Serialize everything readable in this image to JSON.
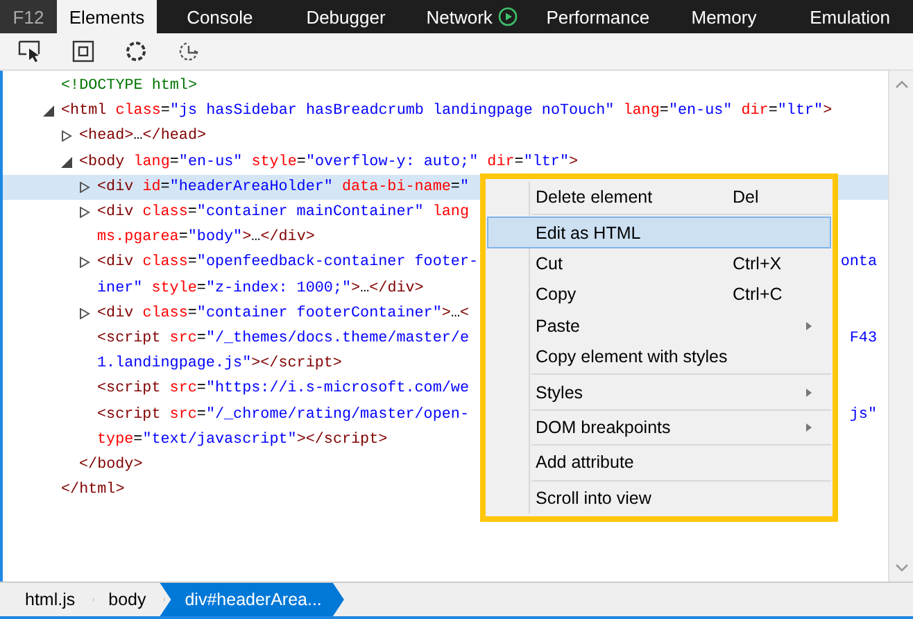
{
  "brand": "F12",
  "tabs": [
    {
      "label": "Elements",
      "kind": "plain",
      "selected": true
    },
    {
      "label": "Console",
      "kind": "plain",
      "selected": false
    },
    {
      "label": "Debugger",
      "kind": "plain",
      "selected": false
    },
    {
      "label": "Network",
      "kind": "recording",
      "selected": false
    },
    {
      "label": "Performance",
      "kind": "plain",
      "selected": false
    },
    {
      "label": "Memory",
      "kind": "plain",
      "selected": false
    },
    {
      "label": "Emulation",
      "kind": "plain",
      "selected": false
    }
  ],
  "toolbar": [
    {
      "kind": "select"
    },
    {
      "kind": "box"
    },
    {
      "kind": "ring"
    },
    {
      "kind": "timer"
    }
  ],
  "tree": [
    {
      "kind": "leaf",
      "selected": false,
      "lines": [
        {
          "tokens": [
            {
              "kind": "doctype",
              "text": "<!DOCTYPE html>"
            }
          ]
        }
      ]
    },
    {
      "kind": "branch",
      "expanded": true,
      "selected": false,
      "lines": [
        {
          "tokens": [
            {
              "kind": "tag",
              "text": "<html"
            },
            {
              "kind": "attr",
              "text": " class"
            },
            {
              "kind": "punct",
              "text": "="
            },
            {
              "kind": "val",
              "text": "\"js hasSidebar hasBreadcrumb landingpage noTouch\""
            },
            {
              "kind": "attr",
              "text": " lang"
            },
            {
              "kind": "punct",
              "text": "="
            },
            {
              "kind": "val",
              "text": "\"en-us\""
            },
            {
              "kind": "attr",
              "text": " dir"
            },
            {
              "kind": "punct",
              "text": "="
            },
            {
              "kind": "val",
              "text": "\"ltr\""
            },
            {
              "kind": "tag",
              "text": ">"
            }
          ]
        }
      ],
      "children": [
        {
          "kind": "branch",
          "expanded": false,
          "selected": false,
          "lines": [
            {
              "tokens": [
                {
                  "kind": "tag",
                  "text": "<head>"
                },
                {
                  "kind": "punct",
                  "text": "…"
                },
                {
                  "kind": "tag",
                  "text": "</head>"
                }
              ]
            }
          ]
        },
        {
          "kind": "branch",
          "expanded": true,
          "selected": false,
          "lines": [
            {
              "tokens": [
                {
                  "kind": "tag",
                  "text": "<body"
                },
                {
                  "kind": "attr",
                  "text": " lang"
                },
                {
                  "kind": "punct",
                  "text": "="
                },
                {
                  "kind": "val",
                  "text": "\"en-us\""
                },
                {
                  "kind": "attr",
                  "text": " style"
                },
                {
                  "kind": "punct",
                  "text": "="
                },
                {
                  "kind": "val",
                  "text": "\"overflow-y: auto;\""
                },
                {
                  "kind": "attr",
                  "text": " dir"
                },
                {
                  "kind": "punct",
                  "text": "="
                },
                {
                  "kind": "val",
                  "text": "\"ltr\""
                },
                {
                  "kind": "tag",
                  "text": ">"
                }
              ]
            }
          ],
          "children": [
            {
              "kind": "branch",
              "expanded": false,
              "selected": true,
              "lines": [
                {
                  "tokens": [
                    {
                      "kind": "tag",
                      "text": "<div"
                    },
                    {
                      "kind": "attr",
                      "text": " id"
                    },
                    {
                      "kind": "punct",
                      "text": "="
                    },
                    {
                      "kind": "val",
                      "text": "\"headerAreaHolder\""
                    },
                    {
                      "kind": "attr",
                      "text": " data-bi-name"
                    },
                    {
                      "kind": "punct",
                      "text": "="
                    },
                    {
                      "kind": "val",
                      "text": "\""
                    }
                  ]
                }
              ]
            },
            {
              "kind": "branch",
              "expanded": false,
              "selected": false,
              "lines": [
                {
                  "tokens": [
                    {
                      "kind": "tag",
                      "text": "<div"
                    },
                    {
                      "kind": "attr",
                      "text": " class"
                    },
                    {
                      "kind": "punct",
                      "text": "="
                    },
                    {
                      "kind": "val",
                      "text": "\"container mainContainer\""
                    },
                    {
                      "kind": "attr",
                      "text": " lang"
                    }
                  ]
                },
                {
                  "tokens": [
                    {
                      "kind": "attr",
                      "text": "ms.pgarea"
                    },
                    {
                      "kind": "punct",
                      "text": "="
                    },
                    {
                      "kind": "val",
                      "text": "\"body\""
                    },
                    {
                      "kind": "tag",
                      "text": ">"
                    },
                    {
                      "kind": "punct",
                      "text": "…"
                    },
                    {
                      "kind": "tag",
                      "text": "</div>"
                    }
                  ]
                }
              ]
            },
            {
              "kind": "branch",
              "expanded": false,
              "selected": false,
              "lines": [
                {
                  "tokens": [
                    {
                      "kind": "tag",
                      "text": "<div"
                    },
                    {
                      "kind": "attr",
                      "text": " class"
                    },
                    {
                      "kind": "punct",
                      "text": "="
                    },
                    {
                      "kind": "val",
                      "text": "\"openfeedback-container footer-"
                    }
                  ],
                  "right": [
                    {
                      "kind": "val",
                      "text": "onta"
                    }
                  ]
                },
                {
                  "tokens": [
                    {
                      "kind": "val",
                      "text": "iner\""
                    },
                    {
                      "kind": "attr",
                      "text": " style"
                    },
                    {
                      "kind": "punct",
                      "text": "="
                    },
                    {
                      "kind": "val",
                      "text": "\"z-index: 1000;\""
                    },
                    {
                      "kind": "tag",
                      "text": ">"
                    },
                    {
                      "kind": "punct",
                      "text": "…"
                    },
                    {
                      "kind": "tag",
                      "text": "</div>"
                    }
                  ]
                }
              ]
            },
            {
              "kind": "branch",
              "expanded": false,
              "selected": false,
              "lines": [
                {
                  "tokens": [
                    {
                      "kind": "tag",
                      "text": "<div"
                    },
                    {
                      "kind": "attr",
                      "text": " class"
                    },
                    {
                      "kind": "punct",
                      "text": "="
                    },
                    {
                      "kind": "val",
                      "text": "\"container footerContainer\""
                    },
                    {
                      "kind": "tag",
                      "text": ">"
                    },
                    {
                      "kind": "punct",
                      "text": "…"
                    },
                    {
                      "kind": "tag",
                      "text": "<"
                    }
                  ]
                }
              ]
            },
            {
              "kind": "leaf",
              "selected": false,
              "lines": [
                {
                  "tokens": [
                    {
                      "kind": "tag",
                      "text": "<script"
                    },
                    {
                      "kind": "attr",
                      "text": " src"
                    },
                    {
                      "kind": "punct",
                      "text": "="
                    },
                    {
                      "kind": "val",
                      "text": "\"/_themes/docs.theme/master/e"
                    }
                  ],
                  "right": [
                    {
                      "kind": "val",
                      "text": "F43"
                    }
                  ]
                },
                {
                  "tokens": [
                    {
                      "kind": "val",
                      "text": "1.landingpage.js\""
                    },
                    {
                      "kind": "tag",
                      "text": "></script>"
                    }
                  ]
                }
              ]
            },
            {
              "kind": "leaf",
              "selected": false,
              "lines": [
                {
                  "tokens": [
                    {
                      "kind": "tag",
                      "text": "<script"
                    },
                    {
                      "kind": "attr",
                      "text": " src"
                    },
                    {
                      "kind": "punct",
                      "text": "="
                    },
                    {
                      "kind": "val",
                      "text": "\"https://i.s-microsoft.com/we"
                    }
                  ]
                }
              ]
            },
            {
              "kind": "leaf",
              "selected": false,
              "lines": [
                {
                  "tokens": [
                    {
                      "kind": "tag",
                      "text": "<script"
                    },
                    {
                      "kind": "attr",
                      "text": " src"
                    },
                    {
                      "kind": "punct",
                      "text": "="
                    },
                    {
                      "kind": "val",
                      "text": "\"/_chrome/rating/master/open-"
                    }
                  ],
                  "right": [
                    {
                      "kind": "val",
                      "text": "js\""
                    }
                  ]
                },
                {
                  "tokens": [
                    {
                      "kind": "attr",
                      "text": "type"
                    },
                    {
                      "kind": "punct",
                      "text": "="
                    },
                    {
                      "kind": "val",
                      "text": "\"text/javascript\""
                    },
                    {
                      "kind": "tag",
                      "text": "></script>"
                    }
                  ]
                }
              ]
            }
          ]
        },
        {
          "kind": "leaf",
          "selected": false,
          "lines": [
            {
              "tokens": [
                {
                  "kind": "tag",
                  "text": "</body>"
                }
              ]
            }
          ]
        }
      ]
    },
    {
      "kind": "leaf",
      "selected": false,
      "lines": [
        {
          "tokens": [
            {
              "kind": "tag",
              "text": "</html>"
            }
          ]
        }
      ]
    }
  ],
  "context_menu": [
    {
      "label": "Delete element",
      "shortcut": "Del",
      "submenu": false,
      "selected": false,
      "separator_after": true
    },
    {
      "label": "Edit as HTML",
      "submenu": false,
      "selected": true,
      "separator_after": false
    },
    {
      "label": "Cut",
      "shortcut": "Ctrl+X",
      "submenu": false,
      "selected": false,
      "separator_after": false
    },
    {
      "label": "Copy",
      "shortcut": "Ctrl+C",
      "submenu": false,
      "selected": false,
      "separator_after": false
    },
    {
      "label": "Paste",
      "submenu": true,
      "selected": false,
      "separator_after": false
    },
    {
      "label": "Copy element with styles",
      "submenu": false,
      "selected": false,
      "separator_after": true
    },
    {
      "label": "Styles",
      "submenu": true,
      "selected": false,
      "separator_after": true
    },
    {
      "label": "DOM breakpoints",
      "submenu": true,
      "selected": false,
      "separator_after": true
    },
    {
      "label": "Add attribute",
      "submenu": false,
      "selected": false,
      "separator_after": true
    },
    {
      "label": "Scroll into view",
      "submenu": false,
      "selected": false,
      "separator_after": false
    }
  ],
  "breadcrumbs": [
    {
      "label": "html.js",
      "selected": false
    },
    {
      "label": "body",
      "selected": false
    },
    {
      "label": "div#headerArea...",
      "selected": true
    }
  ]
}
